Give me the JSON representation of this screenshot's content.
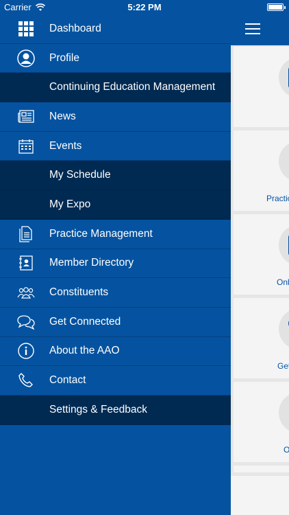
{
  "status_bar": {
    "carrier": "Carrier",
    "time": "5:22 PM"
  },
  "menu": {
    "items": [
      {
        "label": "Dashboard",
        "icon": "grid-icon",
        "sub": false
      },
      {
        "label": "Profile",
        "icon": "profile-icon",
        "sub": false
      },
      {
        "label": "Continuing Education Management",
        "icon": "",
        "sub": true
      },
      {
        "label": "News",
        "icon": "newspaper-icon",
        "sub": false
      },
      {
        "label": "Events",
        "icon": "calendar-icon",
        "sub": false
      },
      {
        "label": "My Schedule",
        "icon": "",
        "sub": true
      },
      {
        "label": "My Expo",
        "icon": "",
        "sub": true
      },
      {
        "label": "Practice Management",
        "icon": "document-icon",
        "sub": false
      },
      {
        "label": "Member Directory",
        "icon": "directory-icon",
        "sub": false
      },
      {
        "label": "Constituents",
        "icon": "group-icon",
        "sub": false
      },
      {
        "label": "Get Connected",
        "icon": "chat-bubbles-icon",
        "sub": false
      },
      {
        "label": "About the AAO",
        "icon": "info-icon",
        "sub": false
      },
      {
        "label": "Contact",
        "icon": "phone-icon",
        "sub": false
      },
      {
        "label": "Settings & Feedback",
        "icon": "",
        "sub": true
      }
    ]
  },
  "content": {
    "cards": [
      {
        "label": ""
      },
      {
        "label": "Practic"
      },
      {
        "label": "Onli"
      },
      {
        "label": "Get"
      },
      {
        "label": "O"
      }
    ]
  },
  "colors": {
    "menu_bg": "#0553a0",
    "sub_bg": "#002a52",
    "panel_bg": "#e6e6e6",
    "card_bg": "#f4f4f4"
  }
}
